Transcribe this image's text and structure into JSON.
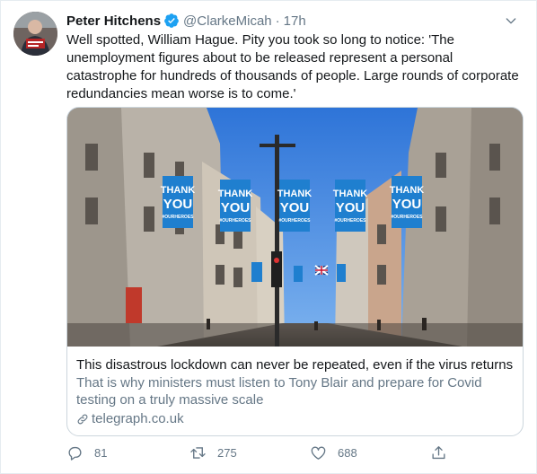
{
  "tweet": {
    "author_name": "Peter Hitchens",
    "handle": "@ClarkeMicah",
    "separator": "·",
    "time": "17h",
    "text": "Well spotted, William Hague. Pity you took so long to notice:  'The unemployment figures about to be released represent a personal catastrophe for hundreds of thousands of people. Large rounds of corporate redundancies mean worse is to come.'"
  },
  "card": {
    "image_banner_line1": "THANK",
    "image_banner_line2": "YOU",
    "image_banner_line3": "#OURHEROES",
    "title": "This disastrous lockdown can never be repeated, even if the virus returns",
    "description": "That is why ministers must listen to Tony Blair and prepare for Covid testing on a truly massive scale",
    "domain": "telegraph.co.uk"
  },
  "actions": {
    "reply_count": "81",
    "retweet_count": "275",
    "like_count": "688"
  },
  "icons": {
    "verified": "verified-badge-icon",
    "menu": "chevron-down-icon",
    "link": "link-icon",
    "reply": "reply-icon",
    "retweet": "retweet-icon",
    "like": "heart-icon",
    "share": "share-icon"
  },
  "colors": {
    "accent": "#1da1f2",
    "text_primary": "#14171a",
    "text_secondary": "#657786",
    "border": "#ccd6dd"
  }
}
